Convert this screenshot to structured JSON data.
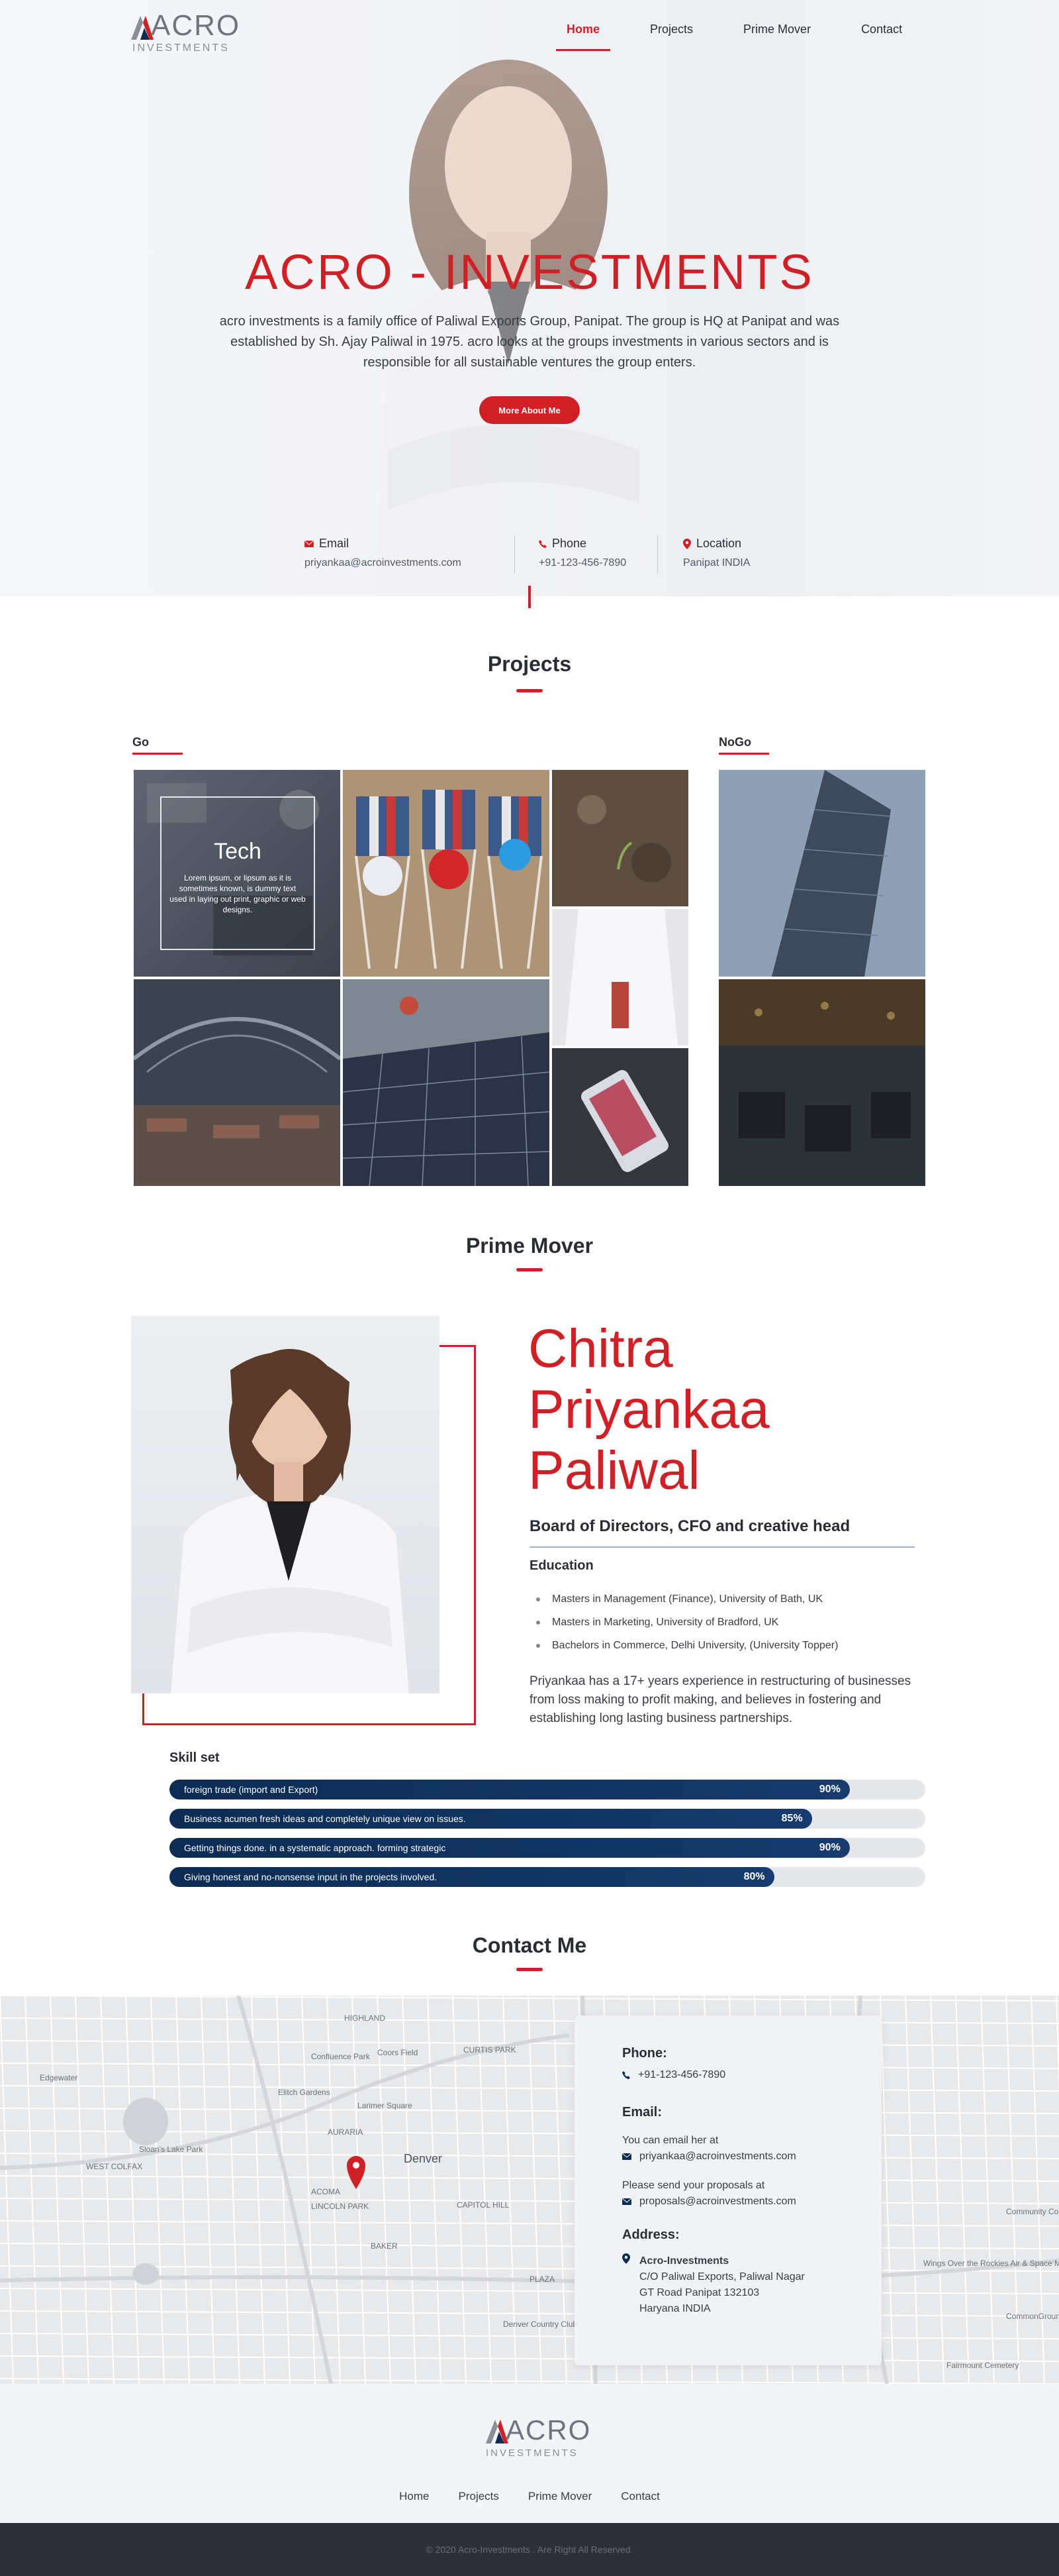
{
  "brand": {
    "name": "ACRO",
    "tagline": "INVESTMENTS",
    "accent": "#d11f26",
    "dark": "#0c2c54"
  },
  "nav": {
    "items": [
      "Home",
      "Projects",
      "Prime Mover",
      "Contact"
    ],
    "active": "Home"
  },
  "hero": {
    "title": "ACRO - INVESTMENTS",
    "text": "acro investments is a family office of Paliwal Exports Group, Panipat. The group is HQ at Panipat and was established by Sh. Ajay Paliwal in 1975. acro looks at the groups investments in various sectors and is responsible for all sustainable ventures the group enters.",
    "button": "More About Me",
    "info": [
      {
        "icon": "mail-icon",
        "label": "Email",
        "value": "priyankaa@acroinvestments.com"
      },
      {
        "icon": "phone-icon",
        "label": "Phone",
        "value": "+91-123-456-7890"
      },
      {
        "icon": "location-icon",
        "label": "Location",
        "value": "Panipat INDIA"
      }
    ]
  },
  "projects": {
    "title": "Projects",
    "go": "Go",
    "nogo": "NoGo",
    "tech": {
      "title": "Tech",
      "desc": "Lorem ipsum, or lipsum as it is sometimes known, is dummy text used in laying out print, graphic or web designs."
    }
  },
  "prime_mover": {
    "title": "Prime Mover",
    "name": [
      "Chitra",
      "Priyankaa",
      "Paliwal"
    ],
    "role": "Board of Directors, CFO and creative head",
    "education_title": "Education",
    "education": [
      "Masters in Management (Finance), University of Bath, UK",
      "Masters in Marketing, University of Bradford, UK",
      "Bachelors in Commerce, Delhi University, (University Topper)"
    ],
    "bio": "Priyankaa has a 17+ years experience in restructuring of businesses from loss making to profit making, and believes in fostering and establishing long lasting business partnerships.",
    "skill_title": "Skill set",
    "skills": [
      {
        "label": "foreign trade (import and Export)",
        "pct": 90,
        "pct_text": "90%"
      },
      {
        "label": "Business acumen fresh ideas and completely unique view on issues.",
        "pct": 85,
        "pct_text": "85%"
      },
      {
        "label": "Getting things done. in a systematic approach. forming strategic",
        "pct": 90,
        "pct_text": "90%"
      },
      {
        "label": "Giving honest and no-nonsense input in the projects involved.",
        "pct": 80,
        "pct_text": "80%"
      }
    ]
  },
  "contact": {
    "title": "Contact Me",
    "phone_title": "Phone:",
    "phone": "+91-123-456-7890",
    "email_title": "Email:",
    "email_note": "You can email her at",
    "email": "priyankaa@acroinvestments.com",
    "proposal_note": "Please send your proposals at",
    "proposal_email": "proposals@acroinvestments.com",
    "address_title": "Address:",
    "address": [
      "Acro-Investments",
      "C/O Paliwal Exports, Paliwal Nagar",
      "GT Road Panipat 132103",
      "Haryana INDIA"
    ],
    "map_labels": [
      "Denver",
      "ACOMA",
      "LINCOLN PARK",
      "CAPITOL HILL",
      "BAKER",
      "Edgewater",
      "Sloan's Lake Park",
      "WEST COLFAX",
      "HIGHLAND",
      "CURTIS PARK",
      "Coors Field",
      "Confluence Park",
      "Larimer Square",
      "Elitch Gardens",
      "Denver Country Club",
      "Fairmount Cemetery",
      "Community College of Aurora",
      "CommonGround Golf Course",
      "Wings Over the Rockies Air & Space Museum",
      "PLAZA",
      "AURARIA"
    ]
  },
  "footer": {
    "menu": [
      "Home",
      "Projects",
      "Prime Mover",
      "Contact"
    ],
    "copyright": "© 2020 Acro-Investments . Are Right All Reserved."
  }
}
